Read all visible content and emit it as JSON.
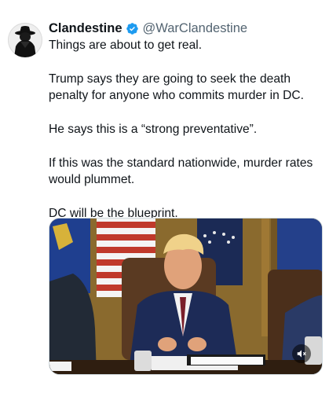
{
  "tweet": {
    "author": {
      "display_name": "Clandestine",
      "handle": "@WarClandestine",
      "verified": true,
      "avatar_icon": "hooded-figure-avatar-icon"
    },
    "text": {
      "p1": "Things are about to get real.",
      "p2": "Trump says they are going to seek the death penalty for anyone who commits murder in DC.",
      "p3": "He says this is a “strong preventative”.",
      "p4": "If this was the standard nationwide, murder rates would plummet.",
      "p5": "DC will be the blueprint."
    },
    "media": {
      "type": "video",
      "sound_icon": "speaker-muted-icon"
    }
  },
  "colors": {
    "verified_blue": "#1d9bf0",
    "handle_gray": "#536471",
    "text": "#0f1419"
  }
}
